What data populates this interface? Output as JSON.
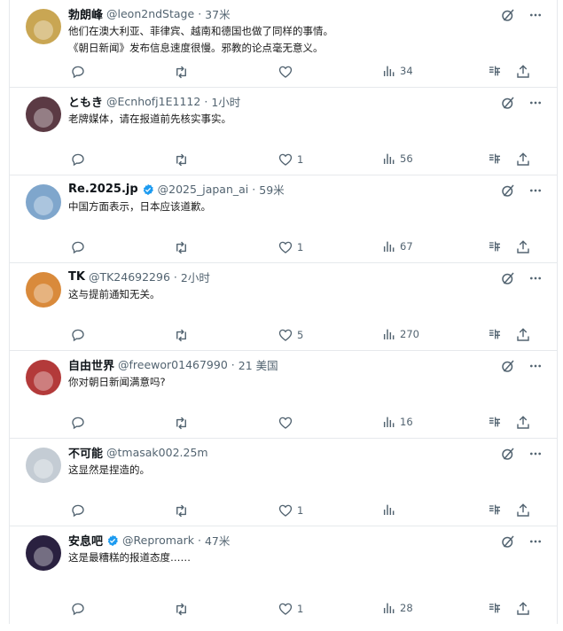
{
  "tweets": [
    {
      "name": "勃朗峰",
      "handle": "@leon2ndStage",
      "time": "37米",
      "verified": false,
      "lines": [
        "他们在澳大利亚、菲律宾、越南和德国也做了同样的事情。",
        "《朝日新闻》发布信息速度很慢。邪教的论点毫无意义。"
      ],
      "likes": "",
      "views": "34",
      "avatar_color": "#c9a653"
    },
    {
      "name": "ともき",
      "handle": "@Ecnhofj1E1112",
      "time": "1小时",
      "verified": false,
      "lines": [
        "老牌媒体，请在报道前先核实事实。"
      ],
      "likes": "1",
      "views": "56",
      "avatar_color": "#5b3a44"
    },
    {
      "name": "Re.2025.jp",
      "handle": "@2025_japan_ai",
      "time": "59米",
      "verified": true,
      "lines": [
        "中国方面表示，日本应该道歉。"
      ],
      "likes": "1",
      "views": "67",
      "avatar_color": "#7fa6cc"
    },
    {
      "name": "TK",
      "handle": "@TK24692296",
      "time": "2小时",
      "verified": false,
      "lines": [
        "这与提前通知无关。"
      ],
      "likes": "5",
      "views": "270",
      "avatar_color": "#d98a3b"
    },
    {
      "name": "自由世界",
      "handle": "@freewor01467990",
      "time": "21 美国",
      "verified": false,
      "lines": [
        "你对朝日新闻满意吗?"
      ],
      "likes": "",
      "views": "16",
      "avatar_color": "#b33a3a"
    },
    {
      "name": "不可能",
      "handle": "@tmasak002.25m",
      "time": "",
      "verified": false,
      "lines": [
        "这显然是捏造的。"
      ],
      "likes": "1",
      "views": "",
      "avatar_color": "#c4ccd4"
    },
    {
      "name": "安息吧",
      "handle": "@Repromark",
      "time": "47米",
      "verified": true,
      "lines": [
        "这是最糟糕的报道态度……"
      ],
      "likes": "1",
      "views": "28",
      "avatar_color": "#2a2140"
    }
  ],
  "icons": {
    "reply": "reply-icon",
    "retweet": "retweet-icon",
    "like": "like-icon",
    "views": "views-icon",
    "bookmark": "bookmark-icon",
    "share": "share-icon",
    "grok": "grok-icon",
    "more": "more-icon"
  },
  "colors": {
    "text_secondary": "#536471",
    "verified_blue": "#1d9bf0",
    "divider": "#e6e9ec"
  }
}
